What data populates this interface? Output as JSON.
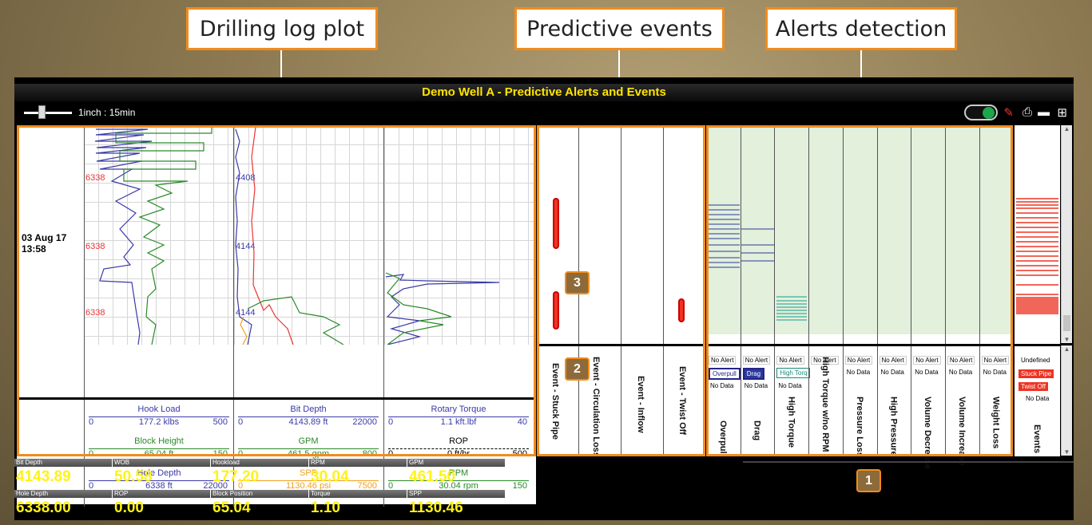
{
  "callouts": {
    "drilling": "Drilling log plot",
    "predictive": "Predictive events",
    "alerts": "Alerts detection"
  },
  "app": {
    "title": "Demo Well A - Predictive Alerts and Events",
    "zoom_label": "1inch : 15min",
    "timestamp_date": "03 Aug 17",
    "timestamp_time": "13:58"
  },
  "depth_labels": {
    "a": "6338",
    "b": "6338",
    "c": "6338",
    "d": "4408",
    "e": "4144",
    "f": "4144"
  },
  "legends": {
    "track1": [
      {
        "name": "Hook Load",
        "min": "0",
        "value": "177.2 klbs",
        "max": "500",
        "color": "#3a3aa8"
      },
      {
        "name": "Block Height",
        "min": "0",
        "value": "65.04 ft",
        "max": "150",
        "color": "#2a8a2a"
      },
      {
        "name": "Hole Depth",
        "min": "0",
        "value": "6338 ft",
        "max": "22000",
        "color": "#3a3aa8"
      }
    ],
    "track2": [
      {
        "name": "Bit Depth",
        "min": "0",
        "value": "4143.89 ft",
        "max": "22000",
        "color": "#3a3aa8"
      },
      {
        "name": "GPM",
        "min": "0",
        "value": "461.5 gpm",
        "max": "800",
        "color": "#2a8a2a"
      },
      {
        "name": "SPP",
        "min": "0",
        "value": "1130.46 psi",
        "max": "7500",
        "color": "#f0a020"
      }
    ],
    "track3": [
      {
        "name": "Rotary Torque",
        "min": "0",
        "value": "1.1 kft.lbf",
        "max": "40",
        "color": "#3a3aa8"
      },
      {
        "name": "ROP",
        "min": "0",
        "value": "0 ft/hr",
        "max": "500",
        "color": "#000000"
      },
      {
        "name": "RPM",
        "min": "0",
        "value": "30.04 rpm",
        "max": "150",
        "color": "#2a8a2a"
      }
    ]
  },
  "events": {
    "c1": "Event - Stuck Pipe",
    "c2": "Event - Circulation Loss",
    "c3": "Event - Inflow",
    "c4": "Event - Twist Off"
  },
  "alerts": {
    "status_no_alert": "No Alert",
    "status_no_data": "No Data",
    "c1": "Overpull",
    "c2": "Drag",
    "c3": "High Torque",
    "c4": "High Torque w/no RPM",
    "c5": "Pressure Loss",
    "c6": "High Pressure",
    "c7": "Volume Decrease",
    "c8": "Volume Increase",
    "c9": "Weight Loss",
    "chip_overpull": "Overpull",
    "chip_drag": "Drag",
    "chip_torque": "High Torq"
  },
  "events_summary": {
    "undefined": "Undefined",
    "stuck": "Stuck Pipe",
    "twist": "Twist Off",
    "nodata": "No Data",
    "label": "Events"
  },
  "badges": {
    "b1": "1",
    "b2": "2",
    "b3": "3"
  },
  "metrics": {
    "bit_depth_label": "Bit Depth",
    "bit_depth": "4143.89",
    "wob_label": "WOB",
    "wob": "50.58",
    "hookload_label": "Hookload",
    "hookload": "177.20",
    "rpm_label": "RPM",
    "rpm": "30.04",
    "gpm_label": "GPM",
    "gpm": "461.50",
    "hole_depth_label": "Hole Depth",
    "hole_depth": "6338.00",
    "rop_label": "ROP",
    "rop": "0.00",
    "block_label": "Block Position",
    "block": "65.04",
    "torque_label": "Torque",
    "torque": "1.10",
    "spp_label": "SPP",
    "spp": "1130.46"
  },
  "colors": {
    "accent": "#f08c1e",
    "title": "#ffe500",
    "metric": "#fff21a",
    "alert_bg": "#e2f0dc"
  }
}
